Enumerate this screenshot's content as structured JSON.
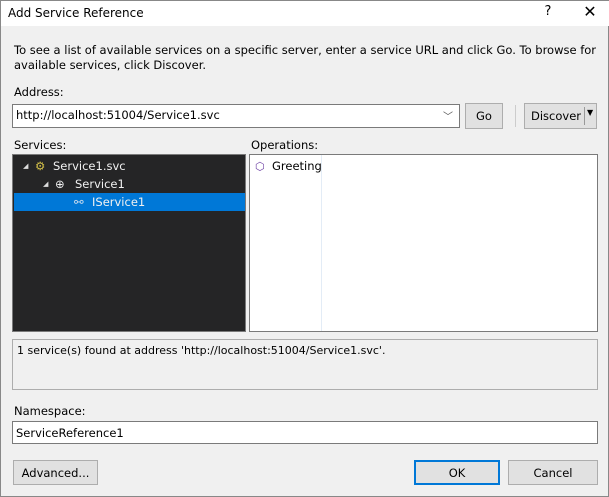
{
  "window": {
    "title": "Add Service Reference",
    "help": "?",
    "close": "✕"
  },
  "description": "To see a list of available services on a specific server, enter a service URL and click Go. To browse for available services, click Discover.",
  "address": {
    "label": "Address:",
    "value": "http://localhost:51004/Service1.svc"
  },
  "buttons": {
    "go": "Go",
    "discover": "Discover",
    "advanced": "Advanced...",
    "ok": "OK",
    "cancel": "Cancel"
  },
  "services": {
    "label": "Services:",
    "items": [
      {
        "label": "Service1.svc",
        "icon": "service-file-icon",
        "expanded": true
      },
      {
        "label": "Service1",
        "icon": "globe-icon",
        "expanded": true
      },
      {
        "label": "IService1",
        "icon": "interface-icon",
        "selected": true
      }
    ]
  },
  "operations": {
    "label": "Operations:",
    "items": [
      {
        "label": "Greeting",
        "icon": "method-icon"
      }
    ]
  },
  "status": "1 service(s) found at address 'http://localhost:51004/Service1.svc'.",
  "namespace": {
    "label": "Namespace:",
    "value": "ServiceReference1"
  },
  "colors": {
    "selection": "#0078d7",
    "tree_bg": "#252526",
    "method": "#6c3fa4"
  }
}
